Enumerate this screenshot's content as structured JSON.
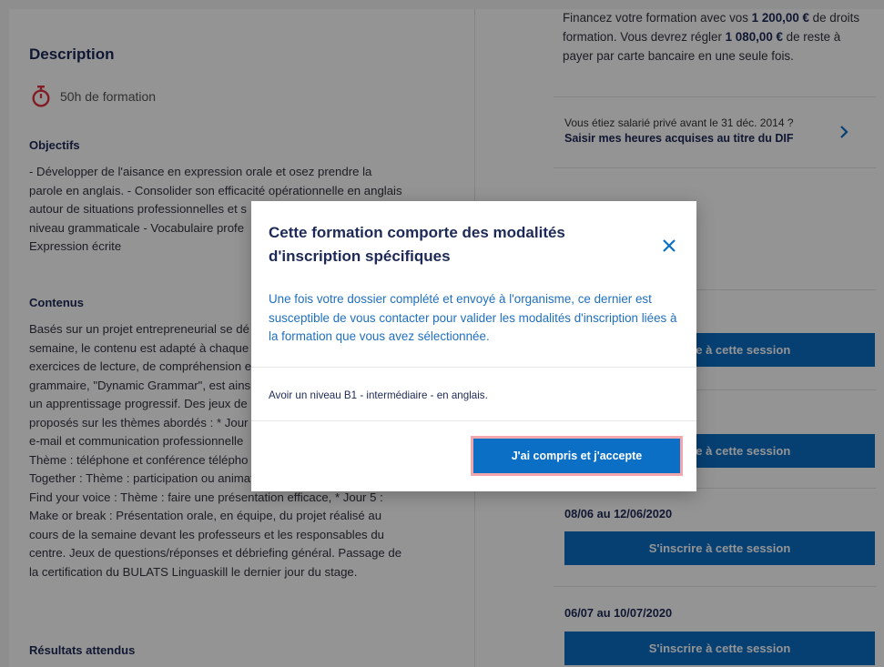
{
  "description": {
    "title": "Description",
    "duration": "50h de formation",
    "objectifs_heading": "Objectifs",
    "objectifs_lines": [
      "- Développer de l'aisance en expression orale et osez prendre la",
      "parole en anglais. - Consolider son efficacité opérationnelle en anglais",
      "autour de situations professionnelles et s",
      "niveau grammaticale - Vocabulaire profe",
      "Expression écrite"
    ],
    "contenus_heading": "Contenus",
    "contenus_lines": [
      "Basés sur un projet entrepreneurial se dé",
      "semaine, le contenu est adapté à chaque",
      "exercices de lecture, de compréhension e",
      "grammaire, \"Dynamic Grammar\", est ains",
      "un apprentissage progressif. Des jeux de",
      "proposés sur les thèmes abordés : * Jour",
      "e-mail et communication professionnelle",
      "Thème : téléphone et conférence télépho",
      "Together : Thème : participation ou animation de réunions, * Jour 4 :",
      "Find your voice : Thème : faire une présentation efficace, * Jour 5 :",
      "Make or break : Présentation orale, en équipe, du projet réalisé au",
      "cours de la semaine devant les professeurs et les responsables du",
      "centre. Jeux de questions/réponses et débriefing général. Passage de",
      "la certification du BULATS Linguaskill le dernier jour du stage."
    ],
    "resultats_heading": "Résultats attendus"
  },
  "financement": {
    "line1_pre": "Financez votre formation avec vos ",
    "line1_amount": "1 200,00 €",
    "line1_post": " de droits",
    "line2_pre": "formation. Vous devrez régler ",
    "line2_amount": "1 080,00 €",
    "line2_post": " de reste à",
    "line3": "payer par carte bancaire en une seule fois."
  },
  "dif": {
    "question": "Vous étiez salarié privé avant le 31 déc. 2014 ?",
    "link": "Saisir mes heures acquises au titre du DIF"
  },
  "sessions": [
    {
      "date": "",
      "button": "S'inscrire à cette session"
    },
    {
      "date": "",
      "button": "S'inscrire à cette session"
    },
    {
      "date": "08/06 au 12/06/2020",
      "button": "S'inscrire à cette session"
    },
    {
      "date": "06/07 au 10/07/2020",
      "button": "S'inscrire à cette session"
    }
  ],
  "modal": {
    "title": "Cette formation comporte des modalités d'inscription spécifiques",
    "body": "Une fois votre dossier complété et envoyé à l'organisme, ce dernier est susceptible de vous contacter pour valider les modalités d'inscription liées à la formation que vous avez sélectionnée.",
    "requirement": "Avoir un niveau B1 - intermédiaire - en anglais.",
    "accept_label": "J'ai compris et j'accepte"
  },
  "colors": {
    "navy": "#1d2956",
    "primary_blue": "#0b6fc6",
    "timer_red": "#e2333f",
    "focus_ring": "#f2a7ad"
  }
}
